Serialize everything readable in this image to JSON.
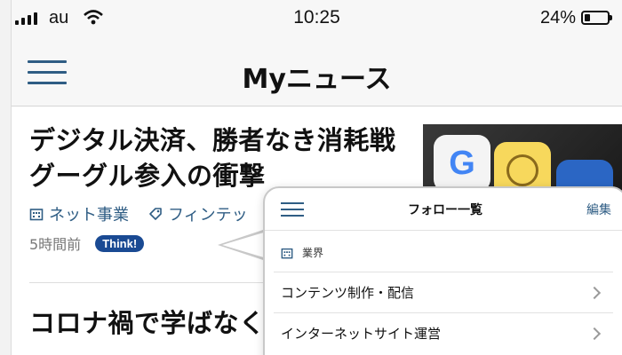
{
  "status_bar": {
    "carrier": "au",
    "time": "10:25",
    "battery_percent": "24%",
    "battery_level": 0.24
  },
  "nav": {
    "title": "Myニュース",
    "menu_icon": "hamburger-menu-icon"
  },
  "articles": [
    {
      "headline_line1": "デジタル決済、勝者なき消耗戦",
      "headline_line2": "グーグル参入の衝撃",
      "tags": [
        {
          "icon": "building-icon",
          "label": "ネット事業"
        },
        {
          "icon": "tag-icon",
          "label": "フィンテッ"
        }
      ],
      "timestamp": "5時間前",
      "badge": "Think!"
    },
    {
      "headline_line1": "コロナ禍で学ばなく"
    }
  ],
  "follow_panel": {
    "title": "フォロー一覧",
    "edit_label": "編集",
    "section_label": "業界",
    "items": [
      {
        "label": "コンテンツ制作・配信"
      },
      {
        "label": "インターネットサイト運営"
      }
    ]
  },
  "colors": {
    "accent": "#2f5d84",
    "badge": "#1a4a93"
  }
}
